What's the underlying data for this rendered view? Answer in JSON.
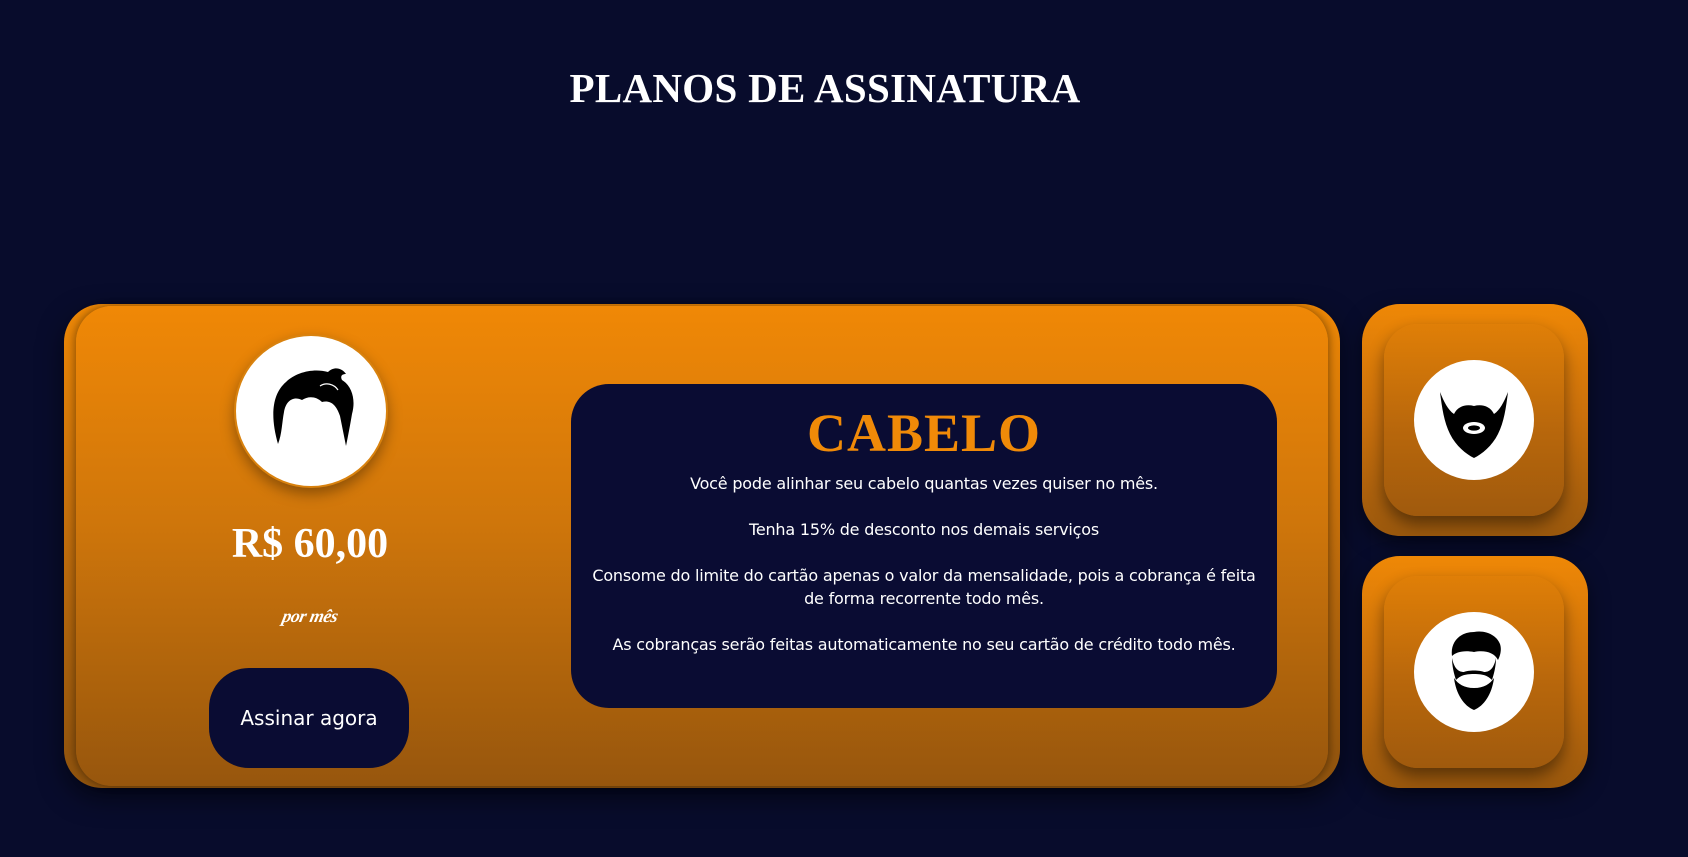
{
  "page": {
    "title": "PLANOS DE ASSINATURA"
  },
  "plan": {
    "icon": "hair-icon",
    "price": "R$ 60,00",
    "period": "por mês",
    "cta_label": "Assinar agora",
    "name": "CABELO",
    "benefits": [
      "Você pode alinhar seu cabelo quantas vezes quiser no mês.",
      "Tenha 15% de desconto nos demais serviços",
      "Consome do limite do cartão apenas o valor da mensalidade, pois a cobrança é feita de forma recorrente todo mês.",
      "As cobranças serão feitas automaticamente no seu cartão de crédito todo mês."
    ]
  },
  "options": [
    {
      "icon": "beard-icon"
    },
    {
      "icon": "hair-and-beard-icon"
    }
  ],
  "colors": {
    "background": "#080c2c",
    "accent": "#f08a08",
    "panel": "#0a0c33",
    "text": "#ffffff"
  }
}
